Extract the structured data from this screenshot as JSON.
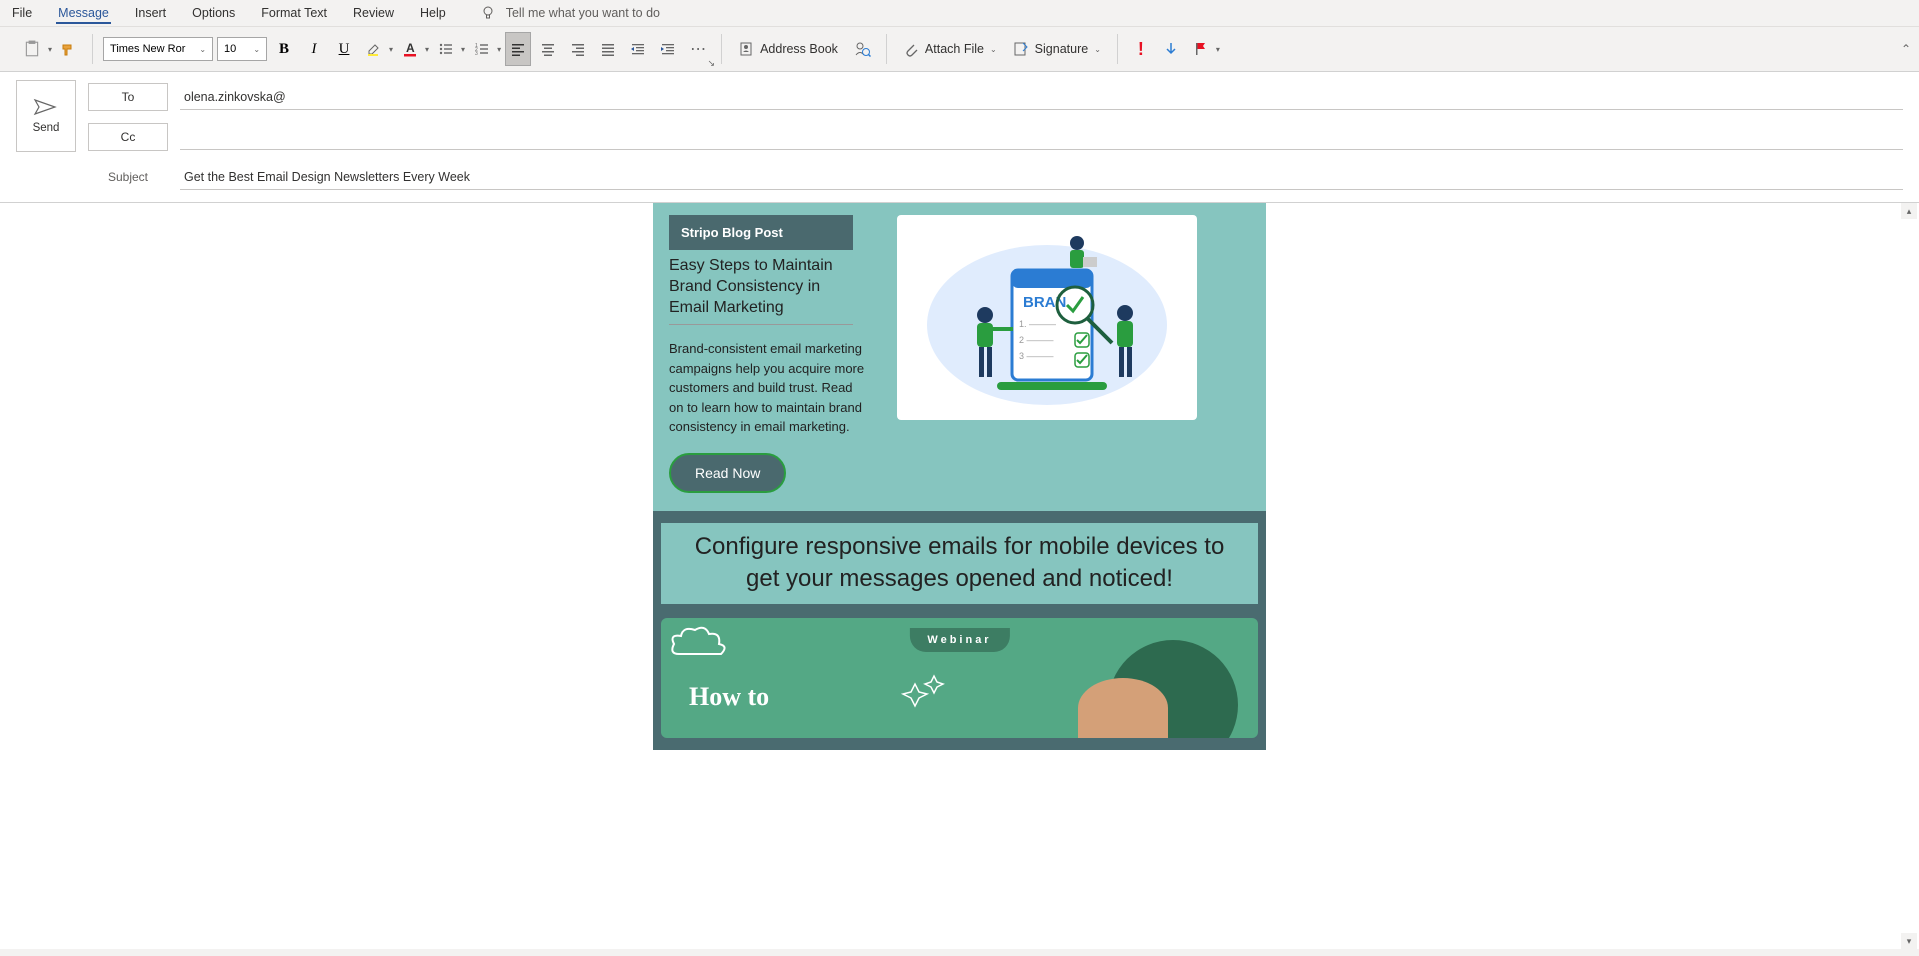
{
  "menu": {
    "file": "File",
    "message": "Message",
    "insert": "Insert",
    "options": "Options",
    "format_text": "Format Text",
    "review": "Review",
    "help": "Help",
    "tell_me": "Tell me what you want to do"
  },
  "ribbon": {
    "font_name": "Times New Ror",
    "font_size": "10",
    "address_book": "Address Book",
    "attach_file": "Attach File",
    "signature": "Signature"
  },
  "compose": {
    "send": "Send",
    "to_label": "To",
    "cc_label": "Cc",
    "subject_label": "Subject",
    "to_value": "olena.zinkovska@",
    "cc_value": "",
    "subject_value": "Get the Best Email Design Newsletters Every Week"
  },
  "email": {
    "badge": "Stripo Blog Post",
    "article_title": "Easy Steps to Maintain Brand Consistency in Email Marketing",
    "article_body": "Brand-consistent email marketing campaigns help you acquire more customers and build trust. Read on to learn how to maintain brand consistency in email marketing.",
    "read_now": "Read Now",
    "banner": "Configure responsive emails for mobile devices to get your messages opened and noticed!",
    "webinar_badge": "Webinar",
    "webinar_title": "How to",
    "illus_brand": "BRAN"
  }
}
